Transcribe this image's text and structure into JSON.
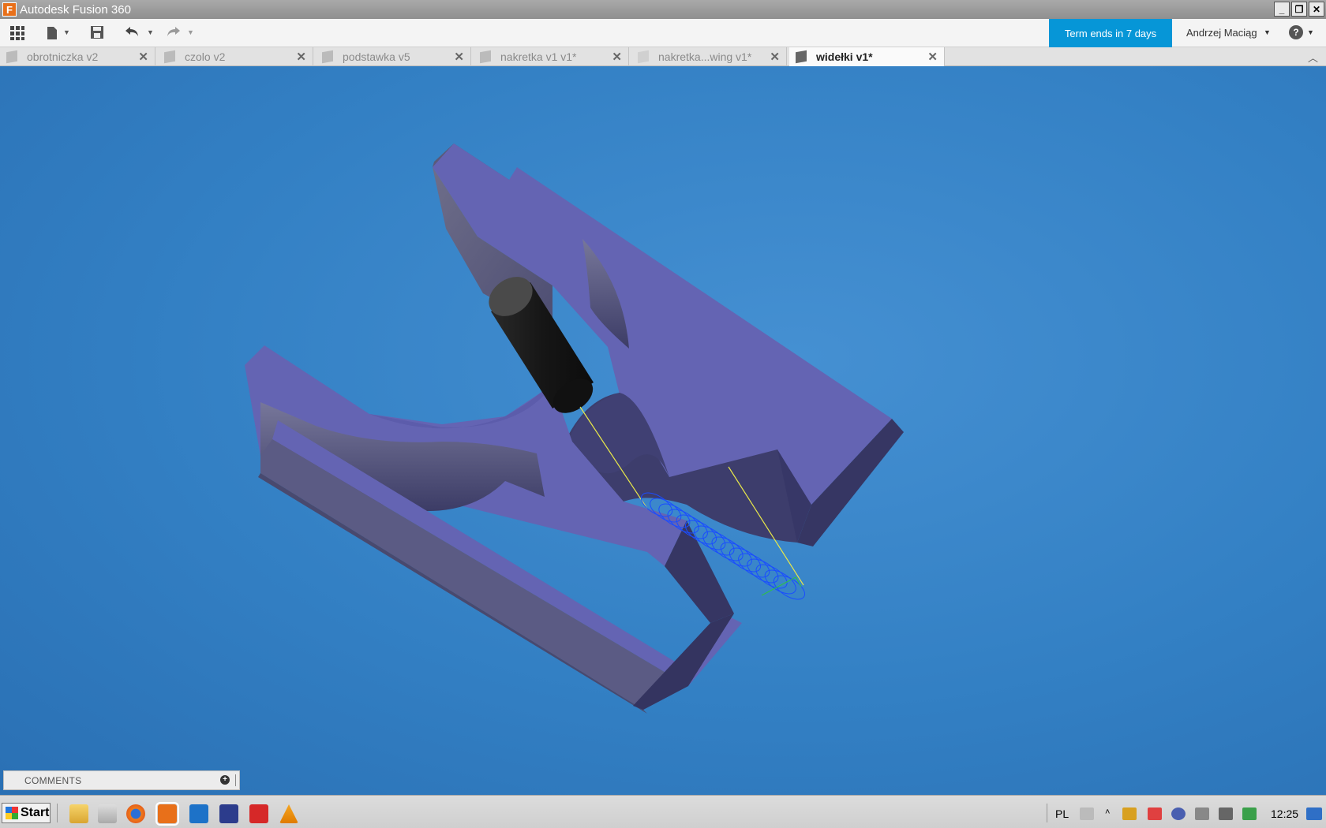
{
  "window": {
    "title": "Autodesk Fusion 360",
    "minimize": "_",
    "restore": "❐",
    "close": "✕"
  },
  "toolbar": {
    "term_label": "Term ends in 7 days",
    "user_name": "Andrzej Maciąg",
    "help_label": "?"
  },
  "tabs": [
    {
      "label": "obrotniczka v2"
    },
    {
      "label": "czolo v2"
    },
    {
      "label": "podstawka v5"
    },
    {
      "label": "nakretka v1 v1*"
    },
    {
      "label": "nakretka...wing v1*"
    },
    {
      "label": "widełki v1*"
    }
  ],
  "comments": {
    "label": "COMMENTS"
  },
  "taskbar": {
    "start_label": "Start",
    "language": "PL",
    "clock": "12:25"
  },
  "colors": {
    "accent": "#0696d7",
    "viewport_bg": "#3380c4",
    "model_top": "#6565b4",
    "model_dark": "#373765",
    "model_side": "#5c5c86"
  }
}
